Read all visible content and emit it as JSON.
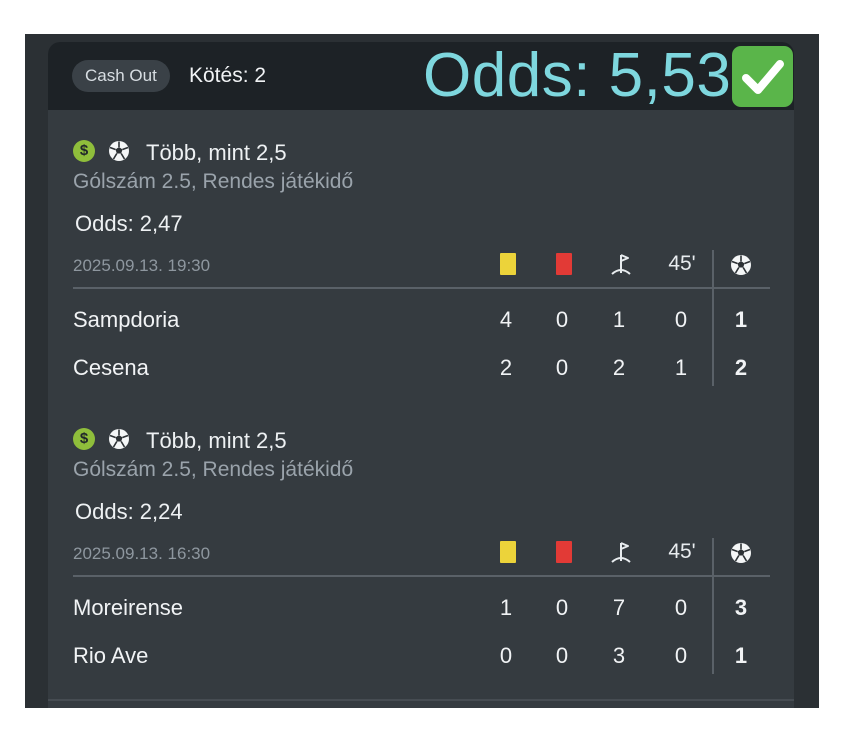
{
  "header": {
    "cashout_label": "Cash Out",
    "kotes_label": "Kötés: 2",
    "overlay_odds": "Odds: 5,53",
    "check_icon": "check-mark-icon",
    "check_color": "#5ab54a",
    "overlay_color": "#7ed7de"
  },
  "icons": {
    "dollar": "$",
    "ball": "football-icon",
    "corner": "corner-flag-icon",
    "yellow_card_color": "#ecd33a",
    "red_card_color": "#e23a36"
  },
  "columns": {
    "half": "45'"
  },
  "bets": [
    {
      "title": "Több, mint 2,5",
      "subtitle": "Gólszám 2.5, Rendes játékidő",
      "odds": "Odds: 2,47",
      "datetime": "2025.09.13.  19:30",
      "teams": [
        {
          "name": "Sampdoria",
          "yellow": "4",
          "red": "0",
          "corners": "1",
          "half": "0",
          "goals": "1"
        },
        {
          "name": "Cesena",
          "yellow": "2",
          "red": "0",
          "corners": "2",
          "half": "1",
          "goals": "2"
        }
      ]
    },
    {
      "title": "Több, mint 2,5",
      "subtitle": "Gólszám 2.5, Rendes játékidő",
      "odds": "Odds: 2,24",
      "datetime": "2025.09.13.  16:30",
      "teams": [
        {
          "name": "Moreirense",
          "yellow": "1",
          "red": "0",
          "corners": "7",
          "half": "0",
          "goals": "3"
        },
        {
          "name": "Rio Ave",
          "yellow": "0",
          "red": "0",
          "corners": "3",
          "half": "0",
          "goals": "1"
        }
      ]
    }
  ]
}
